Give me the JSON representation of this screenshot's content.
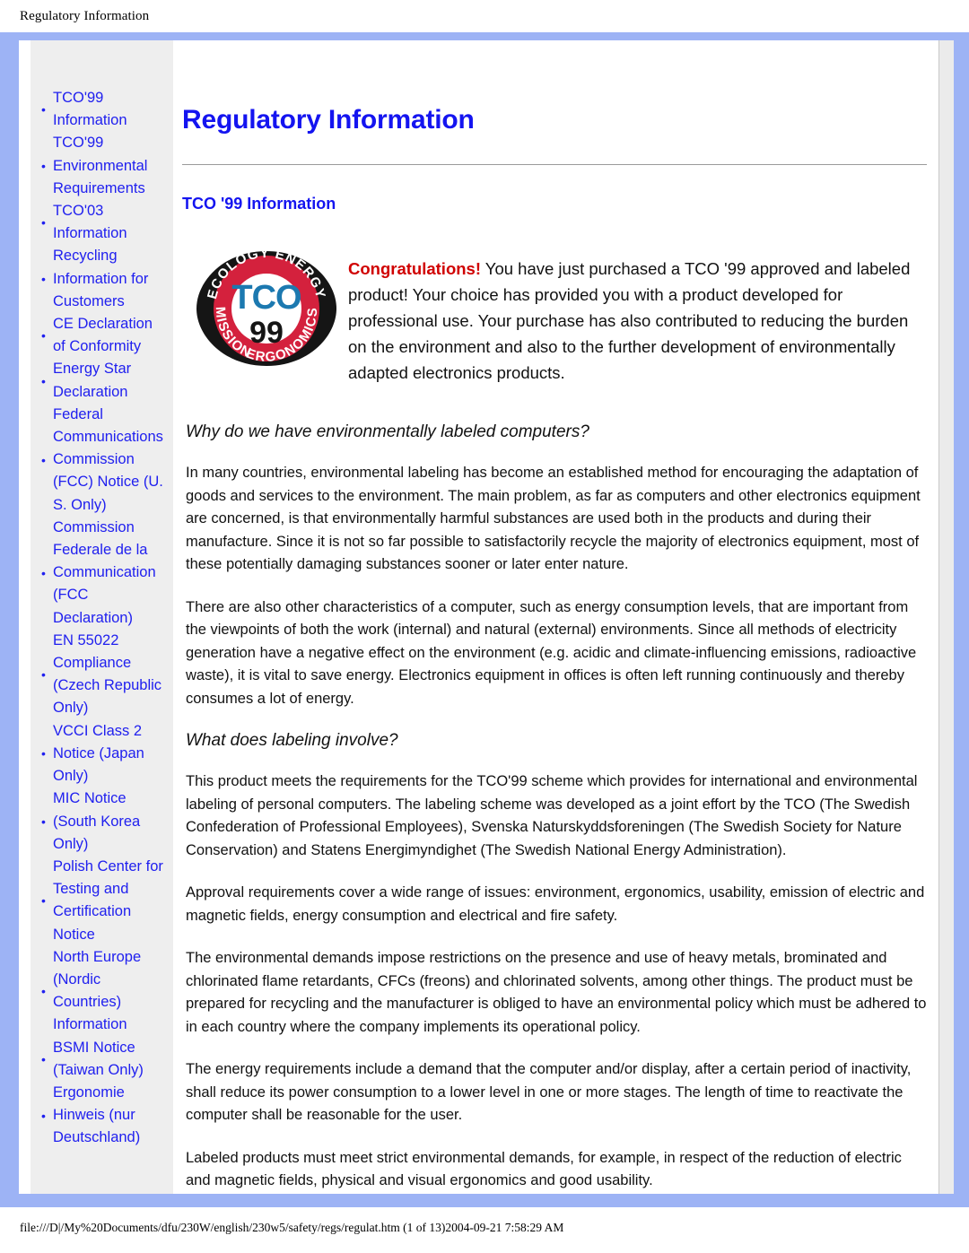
{
  "window": {
    "header_title": "Regulatory Information",
    "footer_path": "file:///D|/My%20Documents/dfu/230W/english/230w5/safety/regs/regulat.htm (1 of 13)2004-09-21 7:58:29 AM"
  },
  "colors": {
    "frame_blue": "#9db3f5",
    "link_blue": "#2020ef",
    "title_blue": "#1414f0",
    "congrats_red": "#d00000",
    "sidebar_bg": "#eeeeee",
    "logo_red": "#d4213d",
    "logo_blue": "#1c79b0",
    "logo_black": "#1a1a1a"
  },
  "sidebar": {
    "items": [
      {
        "label": "TCO'99 Information"
      },
      {
        "label": "TCO'99 Environmental Requirements"
      },
      {
        "label": "TCO'03 Information"
      },
      {
        "label": "Recycling Information for Customers"
      },
      {
        "label": "CE Declaration of Conformity"
      },
      {
        "label": "Energy Star Declaration"
      },
      {
        "label": "Federal Communications Commission (FCC) Notice (U. S. Only)"
      },
      {
        "label": "Commission Federale de la Communication (FCC Declaration)"
      },
      {
        "label": "EN 55022 Compliance (Czech Republic Only)"
      },
      {
        "label": "VCCI Class 2 Notice (Japan Only)"
      },
      {
        "label": "MIC Notice (South Korea Only)"
      },
      {
        "label": "Polish Center for Testing and Certification Notice"
      },
      {
        "label": "North Europe (Nordic Countries) Information"
      },
      {
        "label": "BSMI Notice (Taiwan Only)"
      },
      {
        "label": "Ergonomie Hinweis (nur Deutschland)"
      }
    ]
  },
  "main": {
    "page_title": "Regulatory Information",
    "section_heading": "TCO '99 Information",
    "logo": {
      "name": "TCO 99",
      "center_top": "TCO",
      "center_bottom": "99",
      "arc_top": "ECOLOGY ENERGY",
      "arc_bottom_left": "EMISSIONS",
      "arc_bottom_right": "ERGONOMICS"
    },
    "intro": {
      "lead": "Congratulations!",
      "body": " You have just purchased a TCO '99 approved and labeled product! Your choice has provided you with a product developed for professional use. Your purchase has also contributed to reducing the burden on the environment and also to the further development of environmentally adapted electronics products."
    },
    "sections": [
      {
        "heading": "Why do we have environmentally labeled computers?",
        "paragraphs": [
          "In many countries, environmental labeling has become an established method for encouraging the adaptation of goods and services to the environment. The main problem, as far as computers and other electronics equipment are concerned, is that environmentally harmful substances are used both in the products and during their manufacture. Since it is not so far possible to satisfactorily recycle the majority of electronics equipment, most of these potentially damaging substances sooner or later enter nature.",
          "There are also other characteristics of a computer, such as energy consumption levels, that are important from the viewpoints of both the work (internal) and natural (external) environments. Since all methods of electricity generation have a negative effect on the environment (e.g. acidic and climate-influencing emissions, radioactive waste), it is vital to save energy. Electronics equipment in offices is often left running continuously and thereby consumes a lot of energy."
        ]
      },
      {
        "heading": "What does labeling involve?",
        "paragraphs": [
          "This product meets the requirements for the TCO'99 scheme which provides for international and environmental labeling of personal computers. The labeling scheme was developed as a joint effort by the TCO (The Swedish Confederation of Professional Employees), Svenska Naturskyddsforeningen (The Swedish Society for Nature Conservation) and Statens Energimyndighet (The Swedish National Energy Administration).",
          "Approval requirements cover a wide range of issues: environment, ergonomics, usability, emission of electric and magnetic fields, energy consumption and electrical and fire safety.",
          "The environmental demands impose restrictions on the presence and use of heavy metals, brominated and chlorinated flame retardants, CFCs (freons) and chlorinated solvents, among other things. The product must be prepared for recycling and the manufacturer is obliged to have an environmental policy which must be adhered to in each country where the company implements its operational policy.",
          "The energy requirements include a demand that the computer and/or display, after a certain period of inactivity, shall reduce its power consumption to a lower level in one or more stages. The length of time to reactivate the computer shall be reasonable for the user.",
          "Labeled products must meet strict environmental demands, for example, in respect of the reduction of electric and magnetic fields, physical and visual ergonomics and good usability."
        ]
      }
    ]
  }
}
